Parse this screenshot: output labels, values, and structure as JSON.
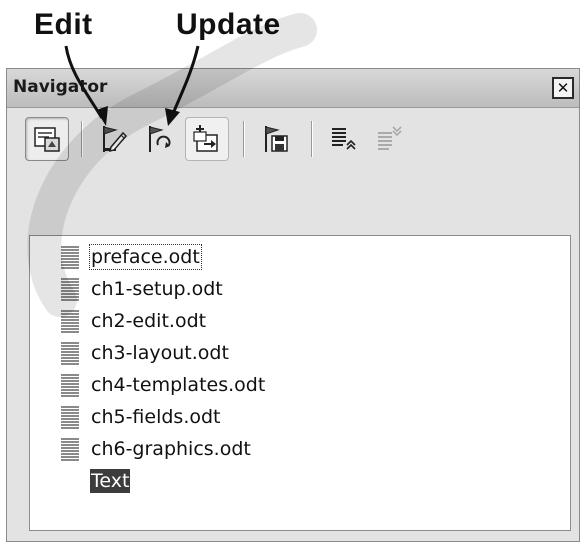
{
  "callouts": {
    "edit": "Edit",
    "update": "Update"
  },
  "window": {
    "title": "Navigator",
    "close_glyph": "✕"
  },
  "toolbar": {
    "buttons": [
      {
        "icon": "toggle-master-view-icon",
        "state": "pressed"
      },
      {
        "icon": "edit-icon",
        "state": "normal"
      },
      {
        "icon": "update-icon",
        "state": "normal"
      },
      {
        "icon": "insert-icon",
        "state": "hover"
      },
      {
        "icon": "save-contents-icon",
        "state": "normal"
      },
      {
        "icon": "move-up-icon",
        "state": "normal"
      },
      {
        "icon": "move-down-icon",
        "state": "disabled"
      }
    ]
  },
  "documents": {
    "items": [
      {
        "label": "preface.odt",
        "icon": "document-icon",
        "state": "focused"
      },
      {
        "label": "ch1-setup.odt",
        "icon": "document-icon",
        "state": "normal"
      },
      {
        "label": "ch2-edit.odt",
        "icon": "document-icon",
        "state": "normal"
      },
      {
        "label": "ch3-layout.odt",
        "icon": "document-icon",
        "state": "normal"
      },
      {
        "label": "ch4-templates.odt",
        "icon": "document-icon",
        "state": "normal"
      },
      {
        "label": "ch5-fields.odt",
        "icon": "document-icon",
        "state": "normal"
      },
      {
        "label": "ch6-graphics.odt",
        "icon": "document-icon",
        "state": "normal"
      },
      {
        "label": "Text",
        "icon": "",
        "state": "selected"
      }
    ]
  },
  "colors": {
    "window_bg": "#e3e3e3",
    "list_bg": "#ffffff",
    "selection_bg": "#3c3c3c",
    "selection_fg": "#ffffff"
  }
}
